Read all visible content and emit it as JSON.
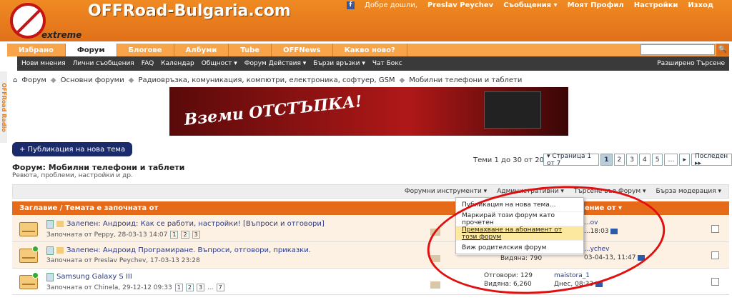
{
  "site": {
    "title": "OFFRoad-Bulgaria.com",
    "logo_word": "extreme"
  },
  "topbar": {
    "welcome": "Добре дошли,",
    "user": "Preslav Peychev",
    "messages": "Съобщения ▾",
    "profile": "Моят Профил",
    "settings": "Настройки",
    "logout": "Изход"
  },
  "tabs": [
    "Избрано",
    "Форум",
    "Блогове",
    "Албуми",
    "Tube",
    "OFFNews",
    "Какво ново?"
  ],
  "subnav": {
    "items": [
      "Нови мнения",
      "Лични съобщения",
      "FAQ",
      "Календар",
      "Общност ▾",
      "Форум Действия ▾",
      "Бързи връзки ▾",
      "Чат Бокс"
    ],
    "advanced": "Разширено Търсене"
  },
  "side": "OFFRoad Radio",
  "breadcrumb": [
    "Форум",
    "Основни форуми",
    "Радиовръзка, комуникация, компютри, електроника, софтуер, GSM",
    "Мобилни телефони и таблети"
  ],
  "banner": {
    "text": "Вземи ОТСТЪПКА!"
  },
  "new_thread": "+ Публикация на нова тема",
  "forum": {
    "title": "Форум: Мобилни телефони и таблети",
    "desc": "Ревюта, проблеми, настройки и др."
  },
  "threads_count": "Теми 1 до 30 от 202",
  "pager": {
    "label": "▾ Страница 1 от 7",
    "pages": [
      "1",
      "2",
      "3",
      "4",
      "5"
    ],
    "dots": "…",
    "next": "▸",
    "last": "Последен ▸▸"
  },
  "toolbar": [
    "Форумни инструменти ▾",
    "Административни ▾",
    "Търсене във Форум ▾",
    "Бърза модерация ▾"
  ],
  "thead": {
    "title": "Заглавие / Темата е започната от",
    "last": "…о мнение от ▾"
  },
  "dropdown": [
    "Публикация на нова тема...",
    "Маркирай този форум като прочетен",
    "Премахване на абонамент от този форум",
    "Виж родителския форум"
  ],
  "rows": [
    {
      "title": "Залепен: Андроид: Как се работи, настройки! [Въпроси и отговори]",
      "start": "Започната от Peppy, 28-03-13 14:07",
      "pages": [
        "1",
        "2",
        "3"
      ],
      "stats1": "",
      "stats2": "",
      "last1": "...ov",
      "last2": "...18:03"
    },
    {
      "title": "Залепен: Андроид Програмиране. Въпроси, отговори, приказки.",
      "start": "Започната от Preslav Peychev, 17-03-13 23:28",
      "pages": [],
      "stats1": "",
      "stats2": "Видяна: 790",
      "last1": "...ychev",
      "last2": "03-04-13, 11:47"
    },
    {
      "title": "Samsung Galaxy S III",
      "start": "Започната от Chinela, 29-12-12 09:33",
      "pages": [
        "1",
        "2",
        "3",
        "...",
        "7"
      ],
      "stats1": "Отговори: 129",
      "stats2": "Видяна: 6,260",
      "last1": "maistora_1",
      "last2": "Днес, 08:33"
    }
  ]
}
